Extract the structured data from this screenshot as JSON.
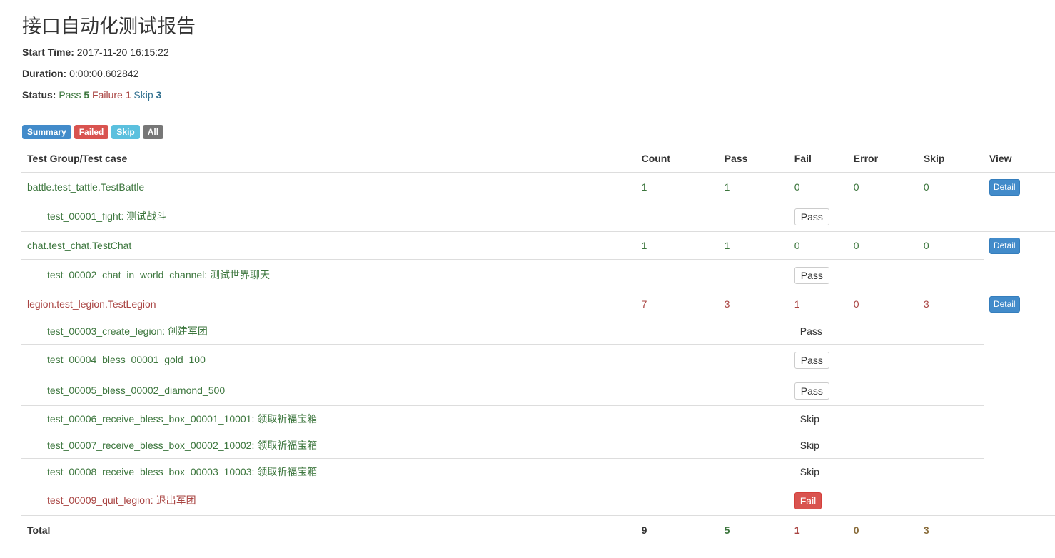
{
  "report": {
    "title": "接口自动化测试报告",
    "start_time_label": "Start Time:",
    "start_time": "2017-11-20 16:15:22",
    "duration_label": "Duration:",
    "duration": "0:00:00.602842",
    "status_label": "Status:",
    "status_pass_label": "Pass",
    "status_pass_count": "5",
    "status_failure_label": "Failure",
    "status_failure_count": "1",
    "status_skip_label": "Skip",
    "status_skip_count": "3"
  },
  "filters": {
    "summary": "Summary",
    "failed": "Failed",
    "skip": "Skip",
    "all": "All"
  },
  "table": {
    "headers": [
      "Test Group/Test case",
      "Count",
      "Pass",
      "Fail",
      "Error",
      "Skip",
      "View"
    ],
    "groups": [
      {
        "name": "battle.test_tattle.TestBattle",
        "count": "1",
        "pass": "1",
        "fail": "0",
        "error": "0",
        "skip": "0",
        "view": "Detail",
        "cases": [
          {
            "name": "test_00001_fight: 测试战斗",
            "status": "Pass"
          }
        ]
      },
      {
        "name": "chat.test_chat.TestChat",
        "count": "1",
        "pass": "1",
        "fail": "0",
        "error": "0",
        "skip": "0",
        "view": "Detail",
        "cases": [
          {
            "name": "test_00002_chat_in_world_channel: 测试世界聊天",
            "status": "Pass"
          }
        ]
      },
      {
        "name": "legion.test_legion.TestLegion",
        "count": "7",
        "pass": "3",
        "fail": "1",
        "error": "0",
        "skip": "3",
        "view": "Detail",
        "cases": [
          {
            "name": "test_00003_create_legion: 创建军团",
            "status": "Pass"
          },
          {
            "name": "test_00004_bless_00001_gold_100",
            "status": "Pass"
          },
          {
            "name": "test_00005_bless_00002_diamond_500",
            "status": "Pass"
          },
          {
            "name": "test_00006_receive_bless_box_00001_10001: 领取祈福宝箱",
            "status": "Skip"
          },
          {
            "name": "test_00007_receive_bless_box_00002_10002: 领取祈福宝箱",
            "status": "Skip"
          },
          {
            "name": "test_00008_receive_bless_box_00003_10003: 领取祈福宝箱",
            "status": "Skip"
          },
          {
            "name": "test_00009_quit_legion: 退出军团",
            "status": "Fail"
          }
        ]
      }
    ],
    "total": {
      "label": "Total",
      "count": "9",
      "pass": "5",
      "fail": "1",
      "error": "0",
      "skip": "3"
    }
  },
  "colors": {
    "pass_text": "#3c763d",
    "fail_text": "#a94442",
    "skip_text": "#31708f",
    "primary": "#428bca",
    "danger": "#d9534f",
    "info": "#5bc0de",
    "default": "#777777"
  }
}
